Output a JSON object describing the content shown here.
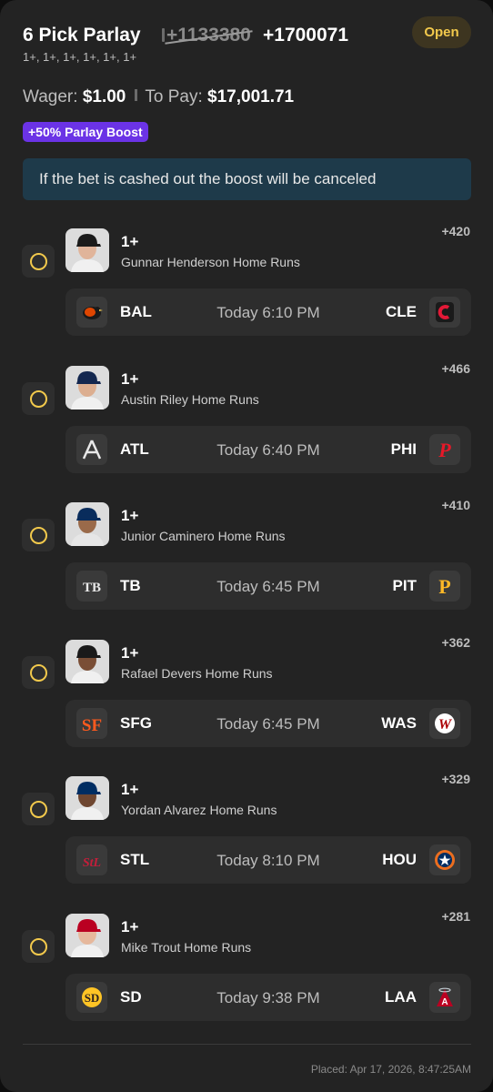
{
  "header": {
    "title": "6 Pick Parlay",
    "old_odds": "+1133380",
    "new_odds": "+1700071",
    "subtitle": "1+, 1+, 1+, 1+, 1+, 1+",
    "status": "Open"
  },
  "wager": {
    "wager_label": "Wager:",
    "wager_value": "$1.00",
    "pay_label": "To Pay:",
    "pay_value": "$17,001.71"
  },
  "boost": "+50% Parlay Boost",
  "notice": "If the bet is cashed out the boost will be canceled",
  "legs": [
    {
      "line": "1+",
      "desc": "Gunnar Henderson Home Runs",
      "odds": "+420",
      "away": "BAL",
      "home": "CLE",
      "time": "Today 6:10 PM",
      "player_icon": "player-headshot-orioles",
      "away_icon": "orioles-logo",
      "home_icon": "guardians-logo",
      "cap": "#1a1a1a",
      "skin": "#e0b49a",
      "jersey": "#f0f0f0"
    },
    {
      "line": "1+",
      "desc": "Austin Riley Home Runs",
      "odds": "+466",
      "away": "ATL",
      "home": "PHI",
      "time": "Today 6:40 PM",
      "player_icon": "player-headshot-braves",
      "away_icon": "braves-logo",
      "home_icon": "phillies-logo",
      "cap": "#13274f",
      "skin": "#dcae90",
      "jersey": "#f0f0f0"
    },
    {
      "line": "1+",
      "desc": "Junior Caminero Home Runs",
      "odds": "+410",
      "away": "TB",
      "home": "PIT",
      "time": "Today 6:45 PM",
      "player_icon": "player-headshot-rays",
      "away_icon": "rays-logo",
      "home_icon": "pirates-logo",
      "cap": "#092c5c",
      "skin": "#9a6a4a",
      "jersey": "#e6e6e6"
    },
    {
      "line": "1+",
      "desc": "Rafael Devers Home Runs",
      "odds": "+362",
      "away": "SFG",
      "home": "WAS",
      "time": "Today 6:45 PM",
      "player_icon": "player-headshot-giants",
      "away_icon": "giants-logo",
      "home_icon": "nationals-logo",
      "cap": "#1a1a1a",
      "skin": "#7a4e36",
      "jersey": "#f0f0f0"
    },
    {
      "line": "1+",
      "desc": "Yordan Alvarez Home Runs",
      "odds": "+329",
      "away": "STL",
      "home": "HOU",
      "time": "Today 8:10 PM",
      "player_icon": "player-headshot-astros",
      "away_icon": "cardinals-logo",
      "home_icon": "astros-logo",
      "cap": "#002d62",
      "skin": "#6e4630",
      "jersey": "#f0f0f0"
    },
    {
      "line": "1+",
      "desc": "Mike Trout Home Runs",
      "odds": "+281",
      "away": "SD",
      "home": "LAA",
      "time": "Today 9:38 PM",
      "player_icon": "player-headshot-angels",
      "away_icon": "padres-logo",
      "home_icon": "angels-logo",
      "cap": "#ba0021",
      "skin": "#e6b89c",
      "jersey": "#f0f0f0"
    }
  ],
  "placed": "Placed: Apr 17, 2026, 8:47:25AM"
}
